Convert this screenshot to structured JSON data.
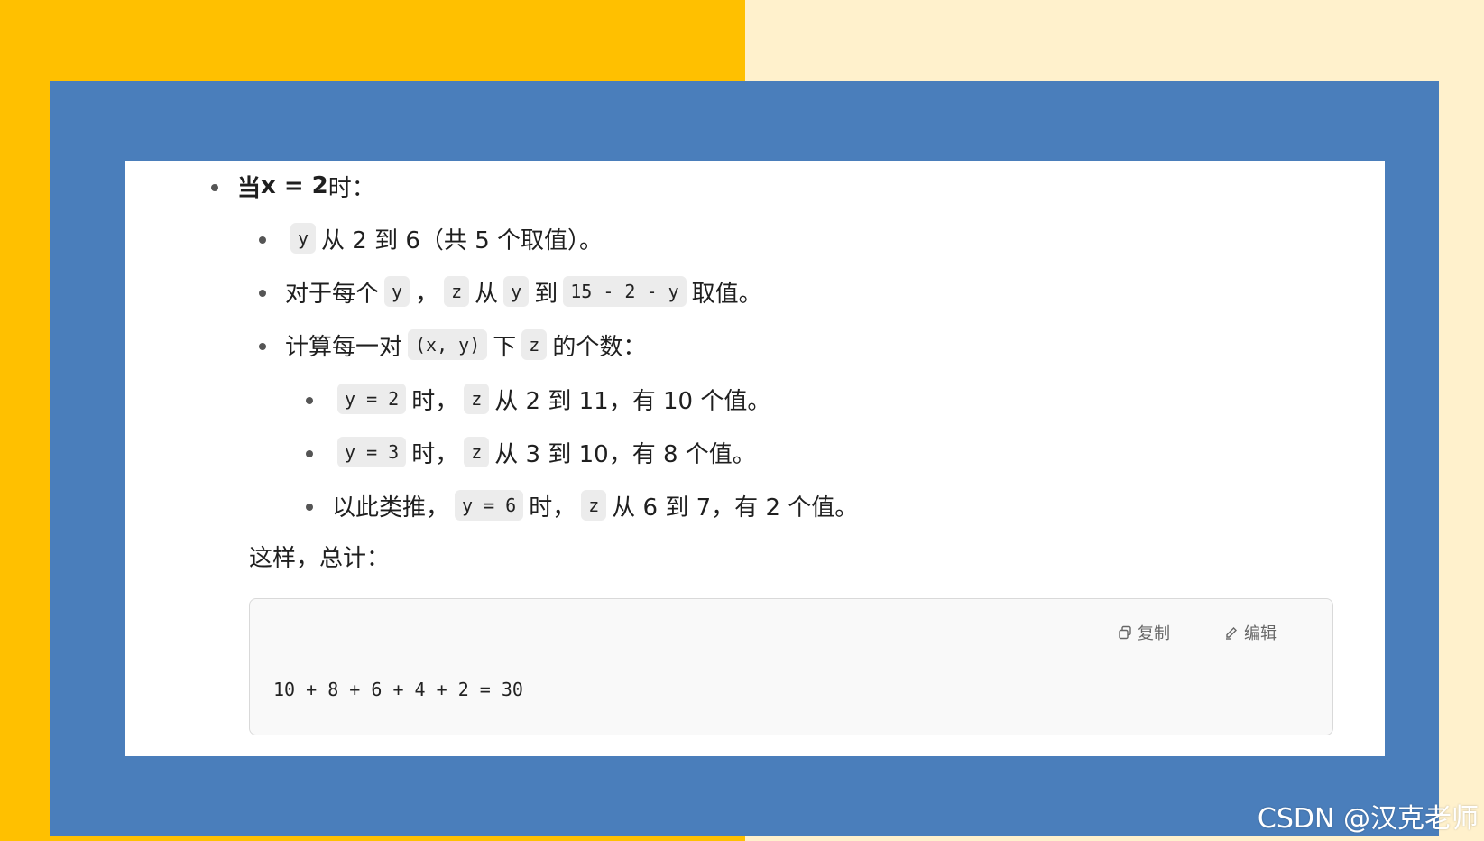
{
  "lines": [
    {
      "bullet_level": 1,
      "parts": [
        {
          "t": "当 ",
          "s": "strong"
        },
        {
          "t": "x = 2",
          "s": "strong"
        },
        {
          "t": " 时：",
          "s": "text"
        }
      ]
    },
    {
      "bullet_level": 2,
      "parts": [
        {
          "t": "y",
          "s": "code"
        },
        {
          "t": "从 2 到 6（共 5 个取值）。",
          "s": "text"
        }
      ]
    },
    {
      "bullet_level": 2,
      "parts": [
        {
          "t": "对于每个",
          "s": "text"
        },
        {
          "t": "y",
          "s": "code"
        },
        {
          "t": "，",
          "s": "text"
        },
        {
          "t": "z",
          "s": "code"
        },
        {
          "t": "从",
          "s": "text"
        },
        {
          "t": "y",
          "s": "code"
        },
        {
          "t": "到",
          "s": "text"
        },
        {
          "t": "15 - 2 - y",
          "s": "code"
        },
        {
          "t": "取值。",
          "s": "text"
        }
      ]
    },
    {
      "bullet_level": 2,
      "parts": [
        {
          "t": "计算每一对",
          "s": "text"
        },
        {
          "t": "(x, y)",
          "s": "code"
        },
        {
          "t": "下",
          "s": "text"
        },
        {
          "t": "z",
          "s": "code"
        },
        {
          "t": "的个数：",
          "s": "text"
        }
      ]
    },
    {
      "bullet_level": 3,
      "parts": [
        {
          "t": "y = 2",
          "s": "code"
        },
        {
          "t": "时，",
          "s": "text"
        },
        {
          "t": "z",
          "s": "code"
        },
        {
          "t": "从 2 到 11，有 10 个值。",
          "s": "text"
        }
      ]
    },
    {
      "bullet_level": 3,
      "parts": [
        {
          "t": "y = 3",
          "s": "code"
        },
        {
          "t": "时，",
          "s": "text"
        },
        {
          "t": "z",
          "s": "code"
        },
        {
          "t": "从 3 到 10，有 8 个值。",
          "s": "text"
        }
      ]
    },
    {
      "bullet_level": 3,
      "parts": [
        {
          "t": "以此类推，",
          "s": "text"
        },
        {
          "t": "y = 6",
          "s": "code"
        },
        {
          "t": "时，",
          "s": "text"
        },
        {
          "t": "z",
          "s": "code"
        },
        {
          "t": "从 6 到 7，有 2 个值。",
          "s": "text"
        }
      ]
    }
  ],
  "summary_label": "这样，总计：",
  "codeblock": {
    "copy_label": "复制",
    "edit_label": "编辑",
    "code": "10 + 8 + 6 + 4 + 2 = 30"
  },
  "watermark": "CSDN @汉克老师",
  "colors": {
    "left_bg": "#ffc000",
    "right_bg": "#fff1cc",
    "frame": "#4a7ebb",
    "panel": "#ffffff"
  }
}
